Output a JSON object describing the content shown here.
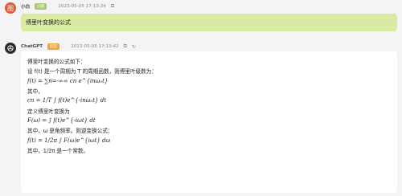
{
  "user_message": {
    "avatar_glyph": "图",
    "avatar_color": "#e0583a",
    "username": "小白",
    "badge": "问题",
    "badge_color": "#a9c96a",
    "timestamp": "2023-05-05 17:13:24",
    "copy_icon": "copy-icon",
    "text": "傅里叶变换的公式"
  },
  "bot_message": {
    "avatar_icon": "chatgpt-logo",
    "avatar_color": "#2b2b2b",
    "username": "ChatGPT",
    "badge": "回答",
    "badge_color": "#f0a53c",
    "timestamp": "2023-05-05 17:13:42",
    "copy_icon": "copy-icon",
    "refresh_icon": "refresh-icon",
    "lines": {
      "l1": "傅里叶变换的公式如下：",
      "l2": "设 f(t) 是一个周期为 T 的周期函数，则傅里叶级数为：",
      "l3": "f(t) = ∑n=-∞∞ cn e^{inω₀t}",
      "l4": "其中，",
      "l5": "cn = 1/T ∫ f(t)e^{-inω₀t} dt",
      "l6": "定义傅里叶变换为",
      "l7": "F(ω) = ∫ f(t)e^{-iωt} dt",
      "l8": "其中，ω 是角频率。则逆变换公式：",
      "l9": "f(t) = 1/2π ∫ F(ω)e^{iωt} dω",
      "l10": "其中，1/2π 是一个常数。"
    }
  }
}
